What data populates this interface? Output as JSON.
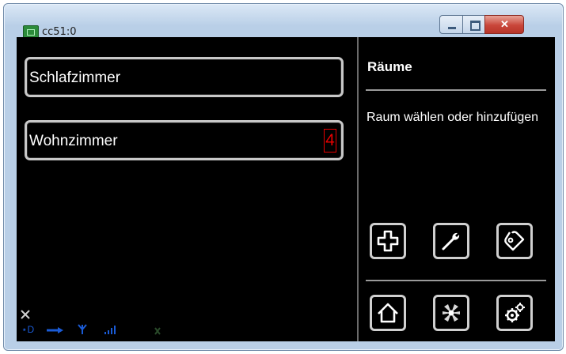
{
  "window": {
    "title": "cc51:0"
  },
  "rooms": [
    {
      "label": "Schlafzimmer"
    },
    {
      "label": "Wohnzimmer",
      "badge": "4"
    }
  ],
  "panel": {
    "title": "Räume",
    "description": "Raum wählen oder hinzufügen"
  },
  "toolbar": {
    "top": [
      "plus-icon",
      "wrench-icon",
      "tag-icon"
    ],
    "bottom": [
      "home-icon",
      "fan-icon",
      "gears-icon"
    ]
  },
  "colors": {
    "background": "#000000",
    "border": "#d0d0d0",
    "badge": "#e60000",
    "status": "#1a5bd6"
  }
}
